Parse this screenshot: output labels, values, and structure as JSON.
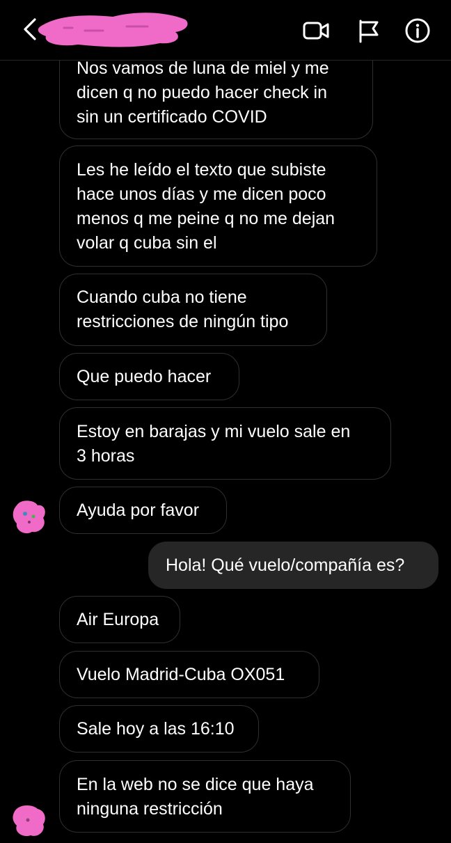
{
  "header": {
    "contact_name": ""
  },
  "colors": {
    "background": "#000000",
    "incoming_border": "#2f2f2f",
    "outgoing_bg": "#262626",
    "redaction": "#f06ac8",
    "text": "#ffffff"
  },
  "icons": {
    "back": "chevron-left-icon",
    "video": "video-call-icon",
    "flag": "flag-icon",
    "info": "info-icon"
  },
  "messages": [
    {
      "direction": "incoming",
      "lines": [
        "Nos vamos de luna de miel y me",
        "dicen q no puedo hacer check in",
        "sin un certificado COVID"
      ]
    },
    {
      "direction": "incoming",
      "lines": [
        "Les he leído el texto que subiste",
        "hace unos días y me dicen poco",
        "menos q me peine q no me dejan",
        "volar q cuba sin el"
      ]
    },
    {
      "direction": "incoming",
      "lines": [
        "Cuando cuba no tiene",
        "restricciones de ningún tipo"
      ]
    },
    {
      "direction": "incoming",
      "lines": [
        "Que puedo hacer"
      ]
    },
    {
      "direction": "incoming",
      "lines": [
        "Estoy en barajas y mi vuelo sale en",
        "3 horas"
      ]
    },
    {
      "direction": "incoming",
      "lines": [
        "Ayuda por favor"
      ]
    },
    {
      "direction": "outgoing",
      "lines": [
        "Hola! Qué vuelo/compañía es?"
      ]
    },
    {
      "direction": "incoming",
      "lines": [
        "Air Europa"
      ]
    },
    {
      "direction": "incoming",
      "lines": [
        "Vuelo Madrid-Cuba OX051"
      ]
    },
    {
      "direction": "incoming",
      "lines": [
        "Sale hoy a las 16:10"
      ]
    },
    {
      "direction": "incoming",
      "lines": [
        "En la web no se dice que haya",
        "ninguna restricción"
      ]
    }
  ]
}
